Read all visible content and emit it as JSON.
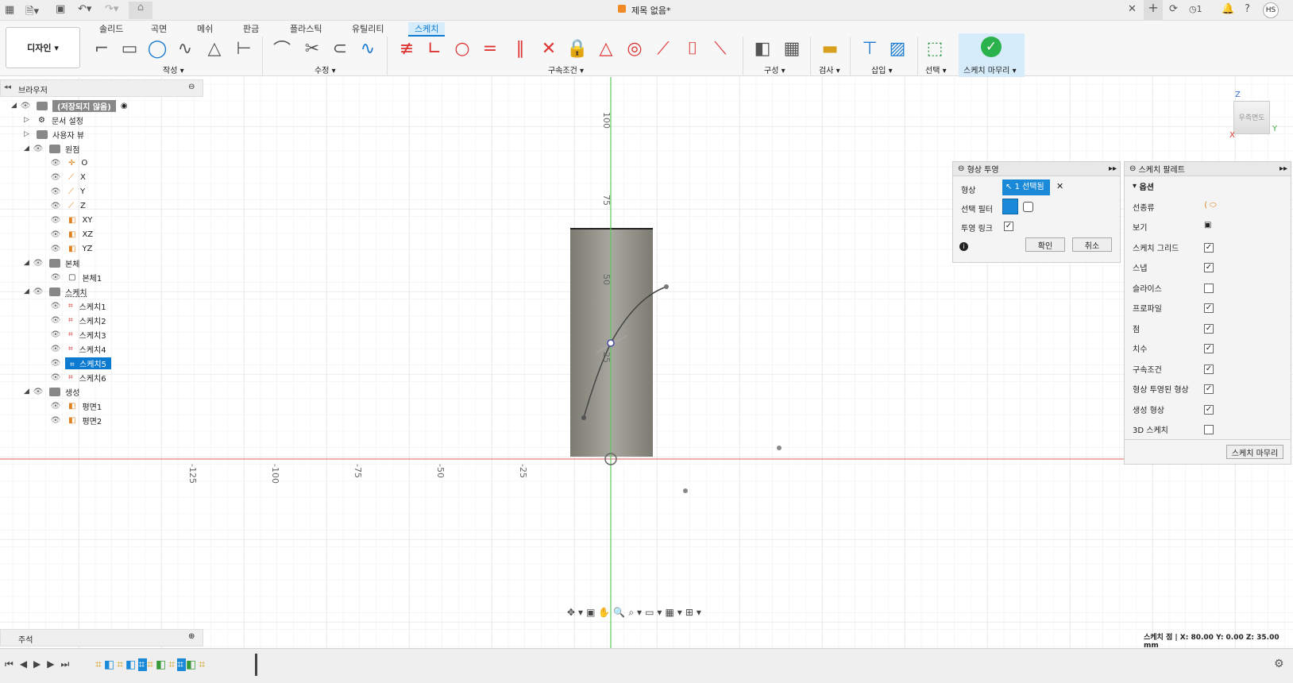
{
  "title": {
    "doc_name": "제목 없음*",
    "user": "HS",
    "jobs": "1"
  },
  "tabs": [
    "솔리드",
    "곡면",
    "메쉬",
    "판금",
    "플라스틱",
    "유틸리티",
    "스케치"
  ],
  "design_menu": "디자인",
  "groups": {
    "create": "작성",
    "modify": "수정",
    "constraints": "구속조건",
    "construct": "구성",
    "inspect": "검사",
    "insert": "삽입",
    "select": "선택",
    "finish": "스케치 마무리"
  },
  "browser": {
    "title": "브라우저",
    "root": "(저장되지 않음)",
    "rows": [
      "문서 설정",
      "사용자 뷰",
      "원점",
      "O",
      "X",
      "Y",
      "Z",
      "XY",
      "XZ",
      "YZ",
      "본체",
      "본체1",
      "스케치",
      "스케치1",
      "스케치2",
      "스케치3",
      "스케치4",
      "스케치5",
      "스케치6",
      "생성",
      "평면1",
      "평면2"
    ]
  },
  "comments": "주석",
  "axis_labels": {
    "v": [
      "100",
      "75",
      "50",
      "25"
    ],
    "h": [
      "-125",
      "-100",
      "-75",
      "-50",
      "-25"
    ]
  },
  "viewcube": {
    "face": "우측면도",
    "x": "X",
    "y": "Y",
    "z": "Z"
  },
  "project": {
    "title": "형상 투영",
    "geometry_label": "형상",
    "geometry_value": "1 선택됨",
    "filter_label": "선택 필터",
    "link_label": "투영 링크",
    "ok": "확인",
    "cancel": "취소"
  },
  "palette": {
    "title": "스케치 팔레트",
    "section": "옵션",
    "rows": [
      {
        "label": "선종류",
        "type": "icon"
      },
      {
        "label": "보기",
        "type": "icon"
      },
      {
        "label": "스케치 그리드",
        "checked": true
      },
      {
        "label": "스냅",
        "checked": true
      },
      {
        "label": "슬라이스",
        "checked": false
      },
      {
        "label": "프로파일",
        "checked": true
      },
      {
        "label": "점",
        "checked": true
      },
      {
        "label": "치수",
        "checked": true
      },
      {
        "label": "구속조건",
        "checked": true
      },
      {
        "label": "형상 투영된 형상",
        "checked": true
      },
      {
        "label": "생성 형상",
        "checked": true
      },
      {
        "label": "3D 스케치",
        "checked": false
      }
    ],
    "finish": "스케치 마무리"
  },
  "status": "스케치 점 | X: 80.00 Y: 0.00 Z: 35.00 mm",
  "colors": {
    "accent": "#0b7ad1",
    "xaxis": "#e06060",
    "yaxis": "#50c050",
    "body": "#8a8a80"
  }
}
